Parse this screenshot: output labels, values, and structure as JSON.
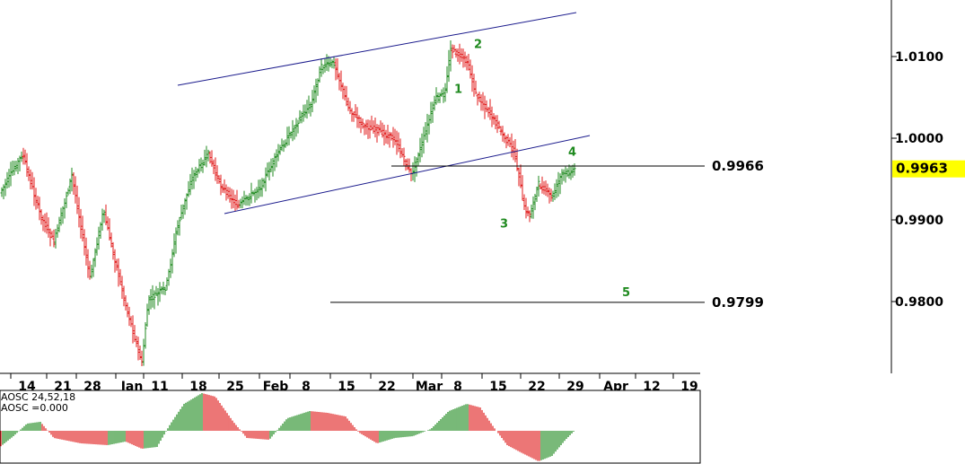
{
  "chart_data": {
    "type": "candlestick",
    "price_axis": {
      "ticks": [
        "1.0100",
        "1.0000",
        "0.9900",
        "0.9800"
      ],
      "tick_values": [
        1.01,
        1.0,
        0.99,
        0.98
      ],
      "range": [
        0.9715,
        1.0265
      ]
    },
    "date_axis": {
      "labels": [
        "14",
        "21",
        "28",
        "Jan",
        "11",
        "18",
        "25",
        "Feb",
        "8",
        "15",
        "22",
        "Mar",
        "8",
        "15",
        "22",
        "29",
        "Apr",
        "12",
        "19"
      ]
    },
    "current_price": "0.9963",
    "levels": [
      {
        "label": "0.9966",
        "value": 0.9966
      },
      {
        "label": "0.9799",
        "value": 0.9799
      }
    ],
    "wave_labels": [
      {
        "label": "1",
        "value": 1.0061
      },
      {
        "label": "2",
        "value": 1.0116
      },
      {
        "label": "3",
        "value": 0.9896
      },
      {
        "label": "4",
        "value": 0.9984
      },
      {
        "label": "5",
        "value": 0.9812
      }
    ],
    "oscillator": {
      "title": "AOSC 24,52,18",
      "value_label": "AOSC =0.000"
    },
    "colors": {
      "up": "#1f8a1f",
      "down": "#e01a1a",
      "channel": "#1a1a8c",
      "highlight": "#ffff00"
    }
  }
}
